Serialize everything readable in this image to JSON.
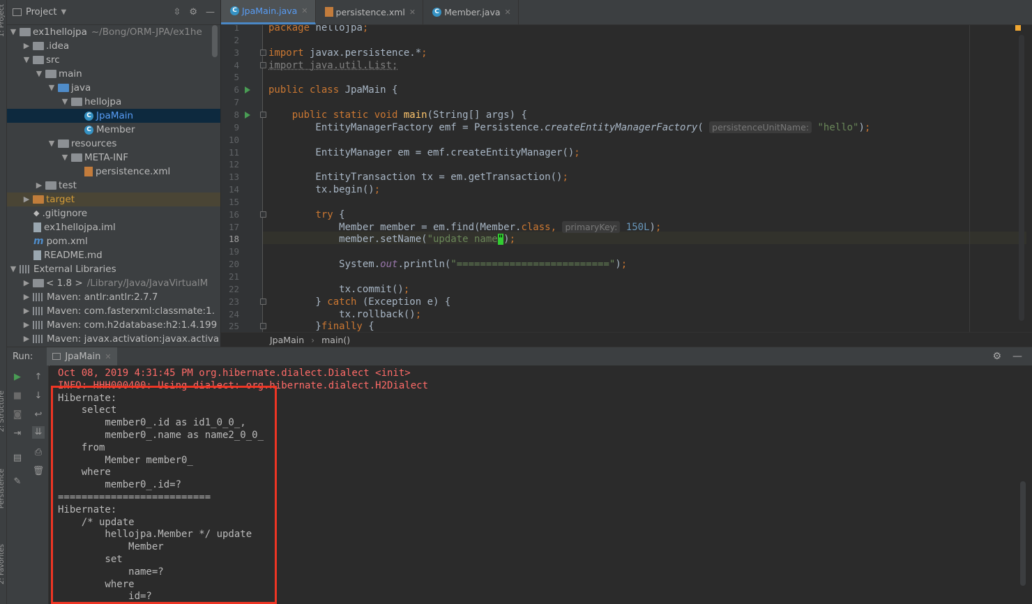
{
  "left_strip": {
    "top_label": "1: Project",
    "mid_label": "2: Structure",
    "mid_label2": "Persistence",
    "bottom_label": "2: Favorites"
  },
  "project_panel": {
    "title": "Project",
    "tree": [
      {
        "label": "ex1hellojpa",
        "suffix": "~/Bong/ORM-JPA/ex1he",
        "depth": 0,
        "arrow": "▼",
        "icon": "folder"
      },
      {
        "label": ".idea",
        "depth": 1,
        "arrow": "▶",
        "icon": "folder"
      },
      {
        "label": "src",
        "depth": 1,
        "arrow": "▼",
        "icon": "folder"
      },
      {
        "label": "main",
        "depth": 2,
        "arrow": "▼",
        "icon": "folder"
      },
      {
        "label": "java",
        "depth": 3,
        "arrow": "▼",
        "icon": "folder-blue"
      },
      {
        "label": "hellojpa",
        "depth": 4,
        "arrow": "▼",
        "icon": "folder"
      },
      {
        "label": "JpaMain",
        "depth": 5,
        "arrow": "",
        "icon": "class",
        "selected": true
      },
      {
        "label": "Member",
        "depth": 5,
        "arrow": "",
        "icon": "class"
      },
      {
        "label": "resources",
        "depth": 3,
        "arrow": "▼",
        "icon": "folder"
      },
      {
        "label": "META-INF",
        "depth": 4,
        "arrow": "▼",
        "icon": "folder"
      },
      {
        "label": "persistence.xml",
        "depth": 5,
        "arrow": "",
        "icon": "xml"
      },
      {
        "label": "test",
        "depth": 2,
        "arrow": "▶",
        "icon": "folder"
      },
      {
        "label": "target",
        "depth": 1,
        "arrow": "▶",
        "icon": "folder-orange",
        "excluded": true
      },
      {
        "label": ".gitignore",
        "depth": 1,
        "arrow": "",
        "icon": "git"
      },
      {
        "label": "ex1hellojpa.iml",
        "depth": 1,
        "arrow": "",
        "icon": "file"
      },
      {
        "label": "pom.xml",
        "depth": 1,
        "arrow": "",
        "icon": "maven"
      },
      {
        "label": "README.md",
        "depth": 1,
        "arrow": "",
        "icon": "file"
      },
      {
        "label": "External Libraries",
        "depth": 0,
        "arrow": "▼",
        "icon": "lib"
      },
      {
        "label": "< 1.8 >",
        "suffix": "/Library/Java/JavaVirtualM",
        "depth": 1,
        "arrow": "▶",
        "icon": "folder"
      },
      {
        "label": "Maven: antlr:antlr:2.7.7",
        "depth": 1,
        "arrow": "▶",
        "icon": "lib"
      },
      {
        "label": "Maven: com.fasterxml:classmate:1.",
        "depth": 1,
        "arrow": "▶",
        "icon": "lib"
      },
      {
        "label": "Maven: com.h2database:h2:1.4.199",
        "depth": 1,
        "arrow": "▶",
        "icon": "lib"
      },
      {
        "label": "Maven: javax.activation:javax.activa",
        "depth": 1,
        "arrow": "▶",
        "icon": "lib"
      }
    ]
  },
  "editor_tabs": [
    {
      "label": "JpaMain.java",
      "icon": "class",
      "active": true
    },
    {
      "label": "persistence.xml",
      "icon": "xml",
      "active": false
    },
    {
      "label": "Member.java",
      "icon": "class",
      "active": false
    }
  ],
  "editor": {
    "current_line": 18,
    "line_numbers": [
      "1",
      "2",
      "3",
      "4",
      "5",
      "6",
      "7",
      "8",
      "9",
      "10",
      "11",
      "12",
      "13",
      "14",
      "15",
      "16",
      "17",
      "18",
      "19",
      "20",
      "21",
      "22",
      "23",
      "24",
      "25"
    ],
    "lines": [
      [
        {
          "t": "package ",
          "c": "kw"
        },
        {
          "t": "hellojpa",
          "c": ""
        },
        {
          "t": ";",
          "c": "kw"
        }
      ],
      [],
      [
        {
          "t": "import ",
          "c": "kw"
        },
        {
          "t": "javax.persistence.*",
          "c": ""
        },
        {
          "t": ";",
          "c": "kw"
        }
      ],
      [
        {
          "t": "import java.util.List;",
          "c": "unused"
        }
      ],
      [],
      [
        {
          "t": "public class ",
          "c": "kw"
        },
        {
          "t": "JpaMain {",
          "c": ""
        }
      ],
      [],
      [
        {
          "t": "    public static void ",
          "c": "kw"
        },
        {
          "t": "main",
          "c": "fn"
        },
        {
          "t": "(String[] args) {",
          "c": ""
        }
      ],
      [
        {
          "t": "        EntityManagerFactory emf = Persistence.",
          "c": ""
        },
        {
          "t": "createEntityManagerFactory",
          "c": "it"
        },
        {
          "t": "( ",
          "c": ""
        },
        {
          "t": "persistenceUnitName:",
          "c": "hint"
        },
        {
          "t": " ",
          "c": ""
        },
        {
          "t": "\"hello\"",
          "c": "str"
        },
        {
          "t": ")",
          "c": ""
        },
        {
          "t": ";",
          "c": "kw"
        }
      ],
      [],
      [
        {
          "t": "        EntityManager em = emf.createEntityManager()",
          "c": ""
        },
        {
          "t": ";",
          "c": "kw"
        }
      ],
      [],
      [
        {
          "t": "        EntityTransaction tx = em.getTransaction()",
          "c": ""
        },
        {
          "t": ";",
          "c": "kw"
        }
      ],
      [
        {
          "t": "        tx.begin()",
          "c": ""
        },
        {
          "t": ";",
          "c": "kw"
        }
      ],
      [],
      [
        {
          "t": "        ",
          "c": ""
        },
        {
          "t": "try ",
          "c": "kw"
        },
        {
          "t": "{",
          "c": ""
        }
      ],
      [
        {
          "t": "            Member member = em.find(Member.",
          "c": ""
        },
        {
          "t": "class",
          "c": "kw"
        },
        {
          "t": ", ",
          "c": "kw"
        },
        {
          "t": "primaryKey:",
          "c": "hint"
        },
        {
          "t": " ",
          "c": ""
        },
        {
          "t": "150L",
          "c": "num"
        },
        {
          "t": ")",
          "c": ""
        },
        {
          "t": ";",
          "c": "kw"
        }
      ],
      [
        {
          "t": "            member.setName(",
          "c": ""
        },
        {
          "t": "\"update name",
          "c": "str"
        },
        {
          "t": "\"",
          "c": "cursor"
        },
        {
          "t": ")",
          "c": ""
        },
        {
          "t": ";",
          "c": "kw"
        }
      ],
      [],
      [
        {
          "t": "            System.",
          "c": ""
        },
        {
          "t": "out",
          "c": "stat"
        },
        {
          "t": ".println(",
          "c": ""
        },
        {
          "t": "\"==========================\"",
          "c": "str"
        },
        {
          "t": ")",
          "c": ""
        },
        {
          "t": ";",
          "c": "kw"
        }
      ],
      [],
      [
        {
          "t": "            tx.commit()",
          "c": ""
        },
        {
          "t": ";",
          "c": "kw"
        }
      ],
      [
        {
          "t": "        } ",
          "c": ""
        },
        {
          "t": "catch ",
          "c": "kw"
        },
        {
          "t": "(Exception e) {",
          "c": ""
        }
      ],
      [
        {
          "t": "            tx.rollback()",
          "c": ""
        },
        {
          "t": ";",
          "c": "kw"
        }
      ],
      [
        {
          "t": "        }",
          "c": ""
        },
        {
          "t": "finally ",
          "c": "kw"
        },
        {
          "t": "{",
          "c": ""
        }
      ]
    ]
  },
  "breadcrumb": {
    "class_name": "JpaMain",
    "method_name": "main()"
  },
  "run_panel": {
    "label": "Run:",
    "tab_label": "JpaMain",
    "console_lines": [
      {
        "t": "Oct 08, 2019 4:31:45 PM org.hibernate.dialect.Dialect <init>",
        "err": true
      },
      {
        "t": "INFO: HHH000400: Using dialect: org.hibernate.dialect.H2Dialect",
        "err": true
      },
      {
        "t": "Hibernate: ",
        "err": false
      },
      {
        "t": "    select",
        "err": false
      },
      {
        "t": "        member0_.id as id1_0_0_,",
        "err": false
      },
      {
        "t": "        member0_.name as name2_0_0_ ",
        "err": false
      },
      {
        "t": "    from",
        "err": false
      },
      {
        "t": "        Member member0_ ",
        "err": false
      },
      {
        "t": "    where",
        "err": false
      },
      {
        "t": "        member0_.id=?",
        "err": false
      },
      {
        "t": "==========================",
        "err": false
      },
      {
        "t": "Hibernate: ",
        "err": false
      },
      {
        "t": "    /* update",
        "err": false
      },
      {
        "t": "        hellojpa.Member */ update",
        "err": false
      },
      {
        "t": "            Member ",
        "err": false
      },
      {
        "t": "        set",
        "err": false
      },
      {
        "t": "            name=? ",
        "err": false
      },
      {
        "t": "        where",
        "err": false
      },
      {
        "t": "            id=?",
        "err": false
      }
    ]
  }
}
